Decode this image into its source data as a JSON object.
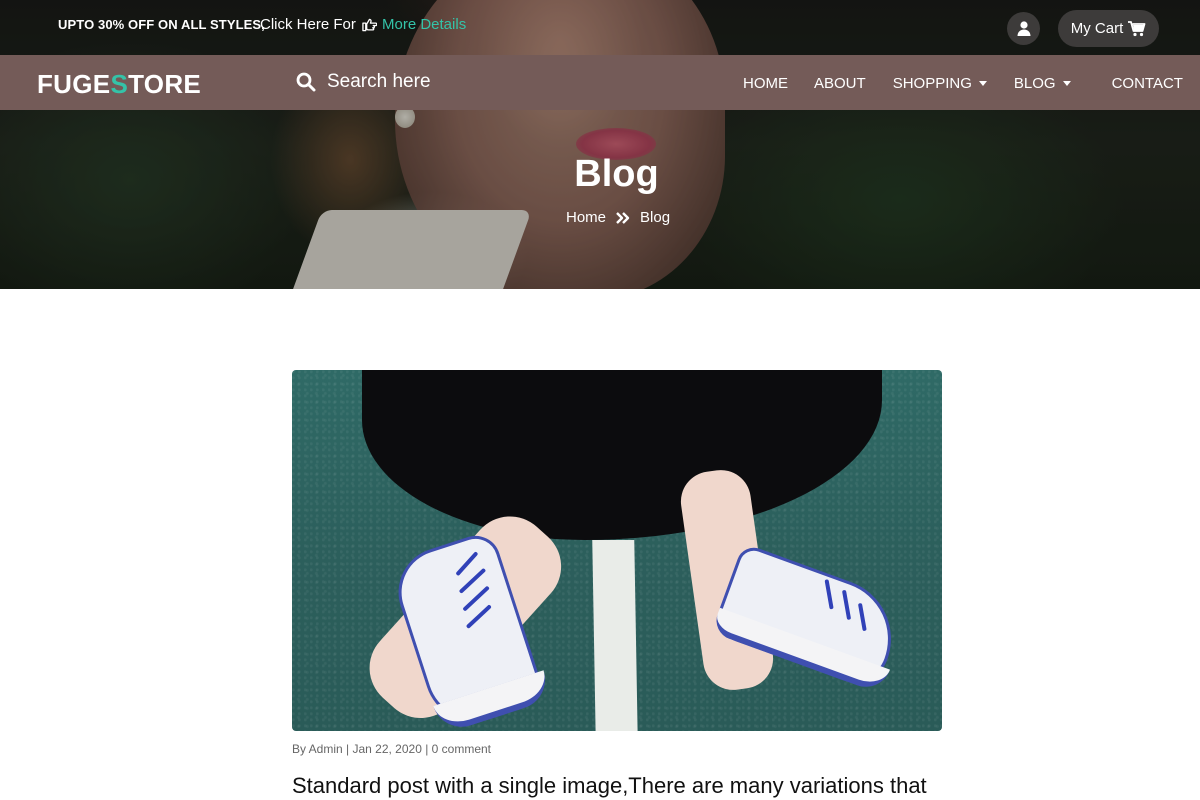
{
  "topbar": {
    "promo_text": "UPTO 30% OFF ON ALL STYLES,",
    "click_here": "Click Here For",
    "more_details": "More Details",
    "cart_label": "My Cart"
  },
  "brand": {
    "logo_part1": "FUGE",
    "logo_accent": "S",
    "logo_part2": "TORE",
    "accent_color": "#34c3a8",
    "nav_color": "#745b58"
  },
  "search": {
    "placeholder": "Search here"
  },
  "nav": {
    "items": [
      {
        "label": "HOME",
        "has_dropdown": false
      },
      {
        "label": "ABOUT",
        "has_dropdown": false
      },
      {
        "label": "SHOPPING",
        "has_dropdown": true
      },
      {
        "label": "BLOG",
        "has_dropdown": true
      },
      {
        "label": "CONTACT",
        "has_dropdown": false
      }
    ]
  },
  "hero": {
    "title": "Blog",
    "breadcrumb": [
      "Home",
      "Blog"
    ]
  },
  "post": {
    "meta": "By Admin | Jan 22, 2020 | 0 comment",
    "title": "Standard post with a single image,There are many variations that"
  },
  "icons": {
    "hand": "hand-point-right-icon",
    "user": "user-icon",
    "cart": "shopping-cart-icon",
    "search": "search-icon",
    "breadcrumb_separator": "double-chevron-right-icon",
    "dropdown": "caret-down-icon"
  }
}
